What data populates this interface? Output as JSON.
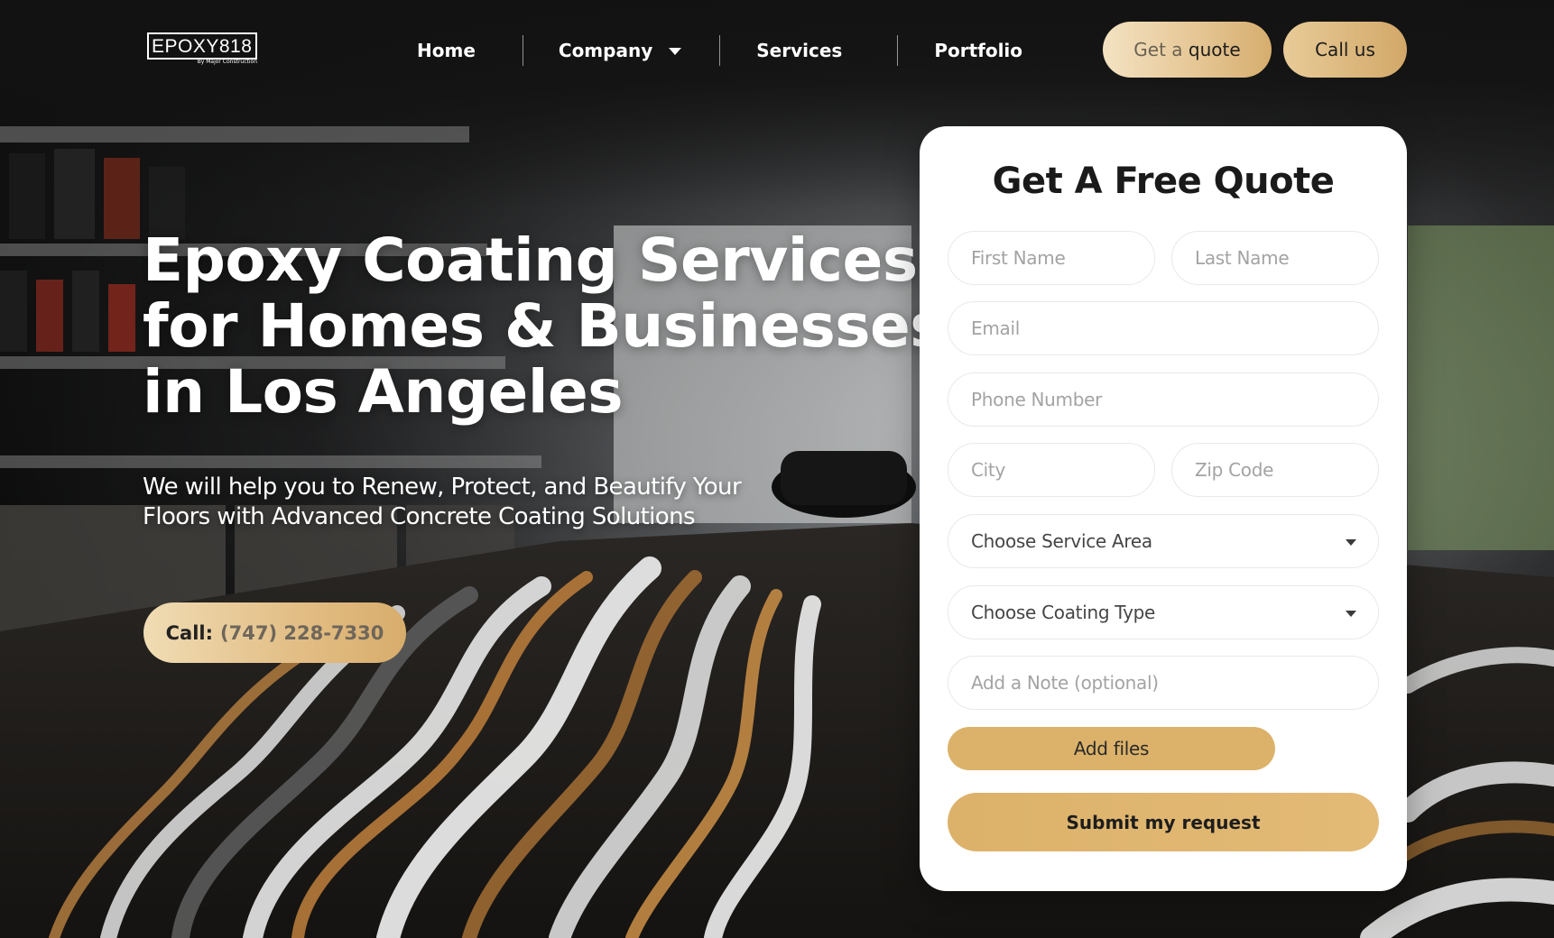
{
  "header": {
    "logo_text": "EPOXY818",
    "logo_sub": "By Major Construction",
    "nav": {
      "home": "Home",
      "company": "Company",
      "services": "Services",
      "portfolio": "Portfolio"
    },
    "quote_button_part1": "Get a",
    "quote_button_part2": "quote",
    "call_button": "Call us"
  },
  "hero": {
    "title_line1": "Epoxy Coating Services",
    "title_line2": "for Homes & Businesses",
    "title_line3": "in Los Angeles",
    "subtitle_line1": "We will help you to Renew, Protect, and Beautify Your",
    "subtitle_line2": "Floors with Advanced Concrete Coating Solutions",
    "call_label": "Call:",
    "call_number": "(747) 228-7330"
  },
  "form": {
    "title": "Get A Free Quote",
    "first_name_placeholder": "First Name",
    "last_name_placeholder": "Last Name",
    "email_placeholder": "Email",
    "phone_placeholder": "Phone Number",
    "city_placeholder": "City",
    "zip_placeholder": "Zip Code",
    "service_area_selected": "Choose Service Area",
    "coating_type_selected": "Choose Coating Type",
    "note_placeholder": "Add a Note (optional)",
    "add_files_label": "Add files",
    "submit_label": "Submit my request"
  },
  "colors": {
    "accent_gold": "#dcb26a",
    "header_bg": "#141414",
    "card_bg": "#ffffff"
  }
}
